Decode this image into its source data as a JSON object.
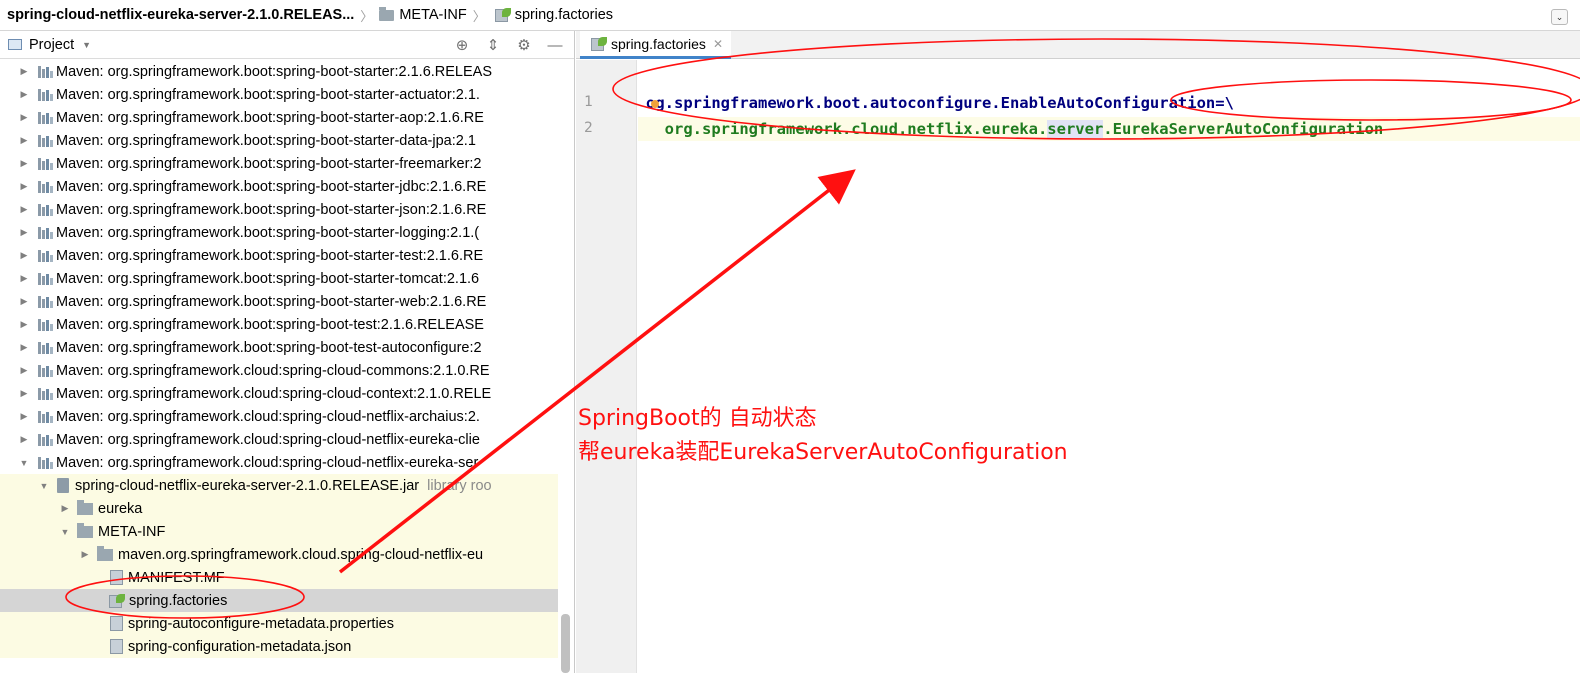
{
  "breadcrumb": {
    "root": "spring-cloud-netflix-eureka-server-2.1.0.RELEAS...",
    "folder": "META-INF",
    "file": "spring.factories"
  },
  "project_panel": {
    "title": "Project",
    "icons": [
      "crosshair-icon",
      "collapse-icon",
      "gear-icon",
      "minimize-icon"
    ]
  },
  "tree": [
    {
      "label": "Maven: org.springframework.boot:spring-boot-starter:2.1.6.RELEAS",
      "arrow": "▶",
      "icon": "library"
    },
    {
      "label": "Maven: org.springframework.boot:spring-boot-starter-actuator:2.1.",
      "arrow": "▶",
      "icon": "library"
    },
    {
      "label": "Maven: org.springframework.boot:spring-boot-starter-aop:2.1.6.RE",
      "arrow": "▶",
      "icon": "library"
    },
    {
      "label": "Maven: org.springframework.boot:spring-boot-starter-data-jpa:2.1",
      "arrow": "▶",
      "icon": "library"
    },
    {
      "label": "Maven: org.springframework.boot:spring-boot-starter-freemarker:2",
      "arrow": "▶",
      "icon": "library"
    },
    {
      "label": "Maven: org.springframework.boot:spring-boot-starter-jdbc:2.1.6.RE",
      "arrow": "▶",
      "icon": "library"
    },
    {
      "label": "Maven: org.springframework.boot:spring-boot-starter-json:2.1.6.RE",
      "arrow": "▶",
      "icon": "library"
    },
    {
      "label": "Maven: org.springframework.boot:spring-boot-starter-logging:2.1.(",
      "arrow": "▶",
      "icon": "library"
    },
    {
      "label": "Maven: org.springframework.boot:spring-boot-starter-test:2.1.6.RE",
      "arrow": "▶",
      "icon": "library"
    },
    {
      "label": "Maven: org.springframework.boot:spring-boot-starter-tomcat:2.1.6",
      "arrow": "▶",
      "icon": "library"
    },
    {
      "label": "Maven: org.springframework.boot:spring-boot-starter-web:2.1.6.RE",
      "arrow": "▶",
      "icon": "library"
    },
    {
      "label": "Maven: org.springframework.boot:spring-boot-test:2.1.6.RELEASE",
      "arrow": "▶",
      "icon": "library"
    },
    {
      "label": "Maven: org.springframework.boot:spring-boot-test-autoconfigure:2",
      "arrow": "▶",
      "icon": "library"
    },
    {
      "label": "Maven: org.springframework.cloud:spring-cloud-commons:2.1.0.RE",
      "arrow": "▶",
      "icon": "library"
    },
    {
      "label": "Maven: org.springframework.cloud:spring-cloud-context:2.1.0.RELE",
      "arrow": "▶",
      "icon": "library"
    },
    {
      "label": "Maven: org.springframework.cloud:spring-cloud-netflix-archaius:2.",
      "arrow": "▶",
      "icon": "library"
    },
    {
      "label": "Maven: org.springframework.cloud:spring-cloud-netflix-eureka-clie",
      "arrow": "▶",
      "icon": "library"
    },
    {
      "label": "Maven: org.springframework.cloud:spring-cloud-netflix-eureka-ser",
      "arrow": "▼",
      "icon": "library"
    },
    {
      "label": "spring-cloud-netflix-eureka-server-2.1.0.RELEASE.jar",
      "extra": "library roo",
      "arrow": "▼",
      "icon": "jar"
    },
    {
      "label": "eureka",
      "arrow": "▶",
      "icon": "folder"
    },
    {
      "label": "META-INF",
      "arrow": "▼",
      "icon": "folder"
    },
    {
      "label": "maven.org.springframework.cloud.spring-cloud-netflix-eu",
      "arrow": "▶",
      "icon": "folder"
    },
    {
      "label": "MANIFEST.MF",
      "arrow": "",
      "icon": "file"
    },
    {
      "label": "spring.factories",
      "arrow": "",
      "icon": "spring"
    },
    {
      "label": "spring-autoconfigure-metadata.properties",
      "arrow": "",
      "icon": "file"
    },
    {
      "label": "spring-configuration-metadata.json",
      "arrow": "",
      "icon": "file"
    }
  ],
  "editor": {
    "tab_label": "spring.factories",
    "line_numbers": [
      "1",
      "2"
    ],
    "line1": {
      "first_char": "o",
      "rest_key": "g.springframework.boot.autoconfigure.EnableAutoConfiguration",
      "suffix": "=\\"
    },
    "line2": {
      "indent": "  ",
      "val_a": "org.springframework.cloud.netflix.eureka.",
      "val_hl": "server",
      "val_b": ".EurekaServerAutoConfiguration"
    }
  },
  "annotation": {
    "line1": "SpringBoot的 自动状态",
    "line2": "帮eureka装配EurekaServerAutoConfiguration",
    "color": "#ff1010"
  }
}
